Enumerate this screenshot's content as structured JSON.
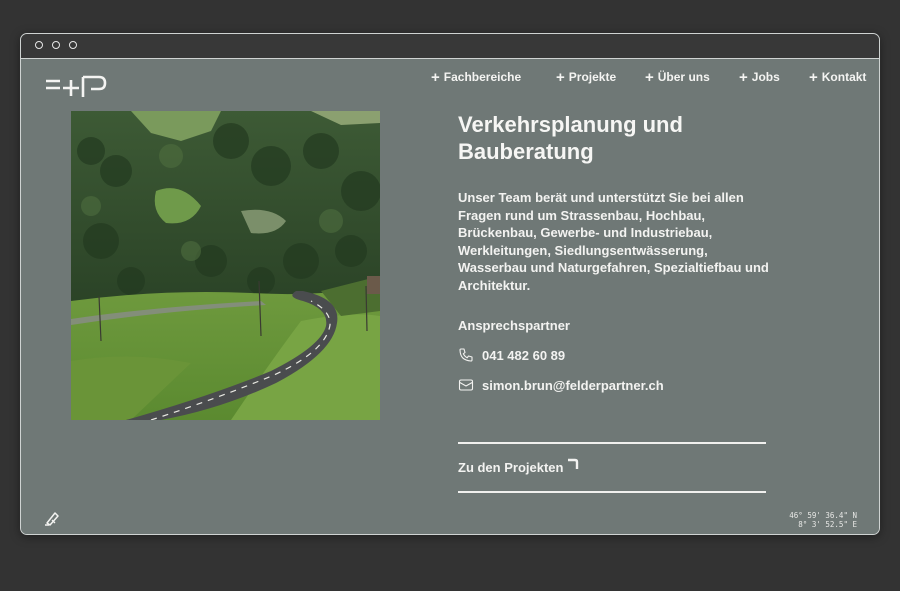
{
  "window": {
    "controls": [
      "close",
      "minimize",
      "maximize"
    ]
  },
  "header": {
    "logo_icon": "felder-partner-logo-icon",
    "nav": [
      {
        "label": "Fachbereiche",
        "icon": "plus-icon"
      },
      {
        "label": "Projekte",
        "icon": "plus-icon"
      },
      {
        "label": "Über uns",
        "icon": "plus-icon"
      },
      {
        "label": "Jobs",
        "icon": "plus-icon"
      },
      {
        "label": "Kontakt",
        "icon": "plus-icon"
      }
    ]
  },
  "main": {
    "image": {
      "subject": "road-landscape-photo"
    },
    "title_line1": "Verkehrsplanung und",
    "title_line2": "Bauberatung",
    "description": "Unser Team berät und unterstützt Sie bei allen Fragen rund um Strassenbau, Hochbau, Brückenbau, Gewerbe- und Industriebau, Werkleitungen, Siedlungsentwässerung, Wasserbau und Naturgefahren, Spezialtiefbau und Architektur.",
    "contact": {
      "label": "Ansprechspartner",
      "phone": "041 482 60 89",
      "phone_icon": "phone-icon",
      "email": "simon.brun@felderpartner.ch",
      "email_icon": "mail-icon"
    },
    "projects_link": "Zu den Projekten",
    "projects_link_icon": "corner-arrow-icon"
  },
  "footer": {
    "left_icon": "pen-icon",
    "coords_line1": "46° 59' 36.4\" N",
    "coords_line2": "8° 3' 52.5\" E"
  },
  "colors": {
    "page_background": "#6f7876",
    "text": "#f3f3f1",
    "window_frame": "#383838",
    "outer_background": "#333333"
  }
}
